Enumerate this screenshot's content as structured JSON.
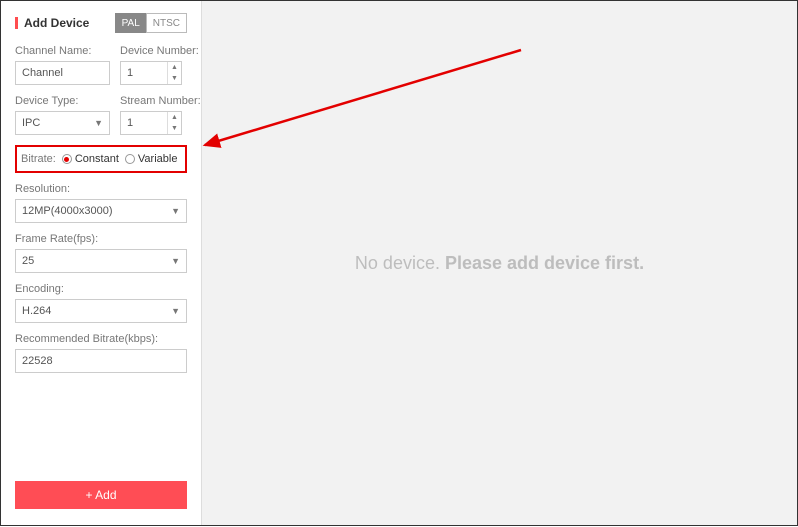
{
  "sidebar": {
    "title": "Add Device",
    "pal_label": "PAL",
    "ntsc_label": "NTSC",
    "channel_name_label": "Channel Name:",
    "channel_name_value": "Channel",
    "device_number_label": "Device Number:",
    "device_number_value": "1",
    "device_type_label": "Device Type:",
    "device_type_value": "IPC",
    "stream_number_label": "Stream Number:",
    "stream_number_value": "1",
    "bitrate_label": "Bitrate:",
    "bitrate_constant": "Constant",
    "bitrate_variable": "Variable",
    "bitrate_selected": "constant",
    "resolution_label": "Resolution:",
    "resolution_value": "12MP(4000x3000)",
    "frame_rate_label": "Frame Rate(fps):",
    "frame_rate_value": "25",
    "encoding_label": "Encoding:",
    "encoding_value": "H.264",
    "rec_bitrate_label": "Recommended Bitrate(kbps):",
    "rec_bitrate_value": "22528",
    "add_button": "+ Add"
  },
  "main": {
    "empty_prefix": "No device. ",
    "empty_bold": "Please add device first."
  },
  "annotation": {
    "arrow_color": "#e30000"
  }
}
